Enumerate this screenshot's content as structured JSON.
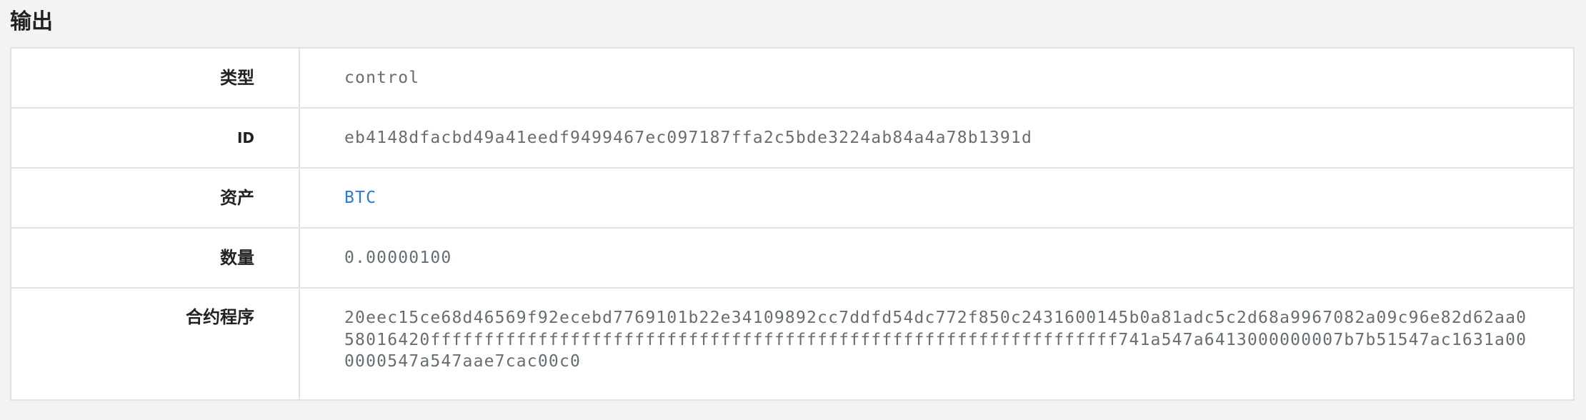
{
  "section": {
    "title": "输出"
  },
  "rows": [
    {
      "label": "类型",
      "value": "control"
    },
    {
      "label": "ID",
      "value": "eb4148dfacbd49a41eedf9499467ec097187ffa2c5bde3224ab84a4a78b1391d"
    },
    {
      "label": "资产",
      "value": "BTC"
    },
    {
      "label": "数量",
      "value": "0.00000100"
    },
    {
      "label": "合约程序",
      "value": "20eec15ce68d46569f92ecebd7769101b22e34109892cc7ddfd54dc772f850c2431600145b0a81adc5c2d68a9967082a09c96e82d62aa058016420ffffffffffffffffffffffffffffffffffffffffffffffffffffffffffffffff741a547a6413000000007b7b51547ac1631a000000547a547aae7cac00c0"
    }
  ],
  "colors": {
    "link": "#2a7bd6",
    "value_text": "#666d73",
    "label_text": "#222222",
    "border": "#e2e2e2",
    "page_background": "#f3f3f3"
  }
}
